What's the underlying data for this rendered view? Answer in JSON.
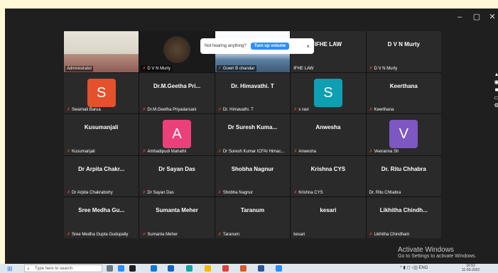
{
  "window": {
    "minimize": "–",
    "maximize": "▢",
    "close": "✕"
  },
  "notice": {
    "text": "Not hearing anything?",
    "button": "Turn up volume",
    "close": "×"
  },
  "tiles": [
    {
      "big": "",
      "label": "Administrator",
      "video": "admin"
    },
    {
      "big": "",
      "label": "D V N Murty",
      "video": "murty"
    },
    {
      "big": "",
      "label": "Gowri B chandar",
      "video": "gowri"
    },
    {
      "big": "IFHE LAW",
      "label": "IFHE LAW",
      "mic": false
    },
    {
      "big": "D V N Murty",
      "label": "D V N Murty"
    },
    {
      "avatar": "S",
      "color": "#e4512b",
      "label": "Swarnali Barua"
    },
    {
      "big": "Dr.M.Geetha Pri...",
      "label": "Dr.M.Geetha Priyadarsani"
    },
    {
      "big": "Dr. Himavathi. T",
      "label": "Dr. Himavathi. T"
    },
    {
      "avatar": "S",
      "color": "#0e9fb3",
      "label": "s ravi"
    },
    {
      "big": "Keerthana",
      "label": "Keerthana"
    },
    {
      "big": "Kusumanjali",
      "label": "Kusumanjali"
    },
    {
      "avatar": "A",
      "color": "#ec407a",
      "label": "Ambadipudi Mahathi"
    },
    {
      "big": "Dr Suresh Kuma...",
      "label": "Dr Suresh Kumar ICFAI Himac..."
    },
    {
      "big": "Anwesha",
      "label": "Anwesha"
    },
    {
      "avatar": "V",
      "color": "#7e57c2",
      "label": "Veeranna Sh"
    },
    {
      "big": "Dr Arpita Chakr...",
      "label": "Dr Arpita Chakraborty"
    },
    {
      "big": "Dr Sayan Das",
      "label": "Dr Sayan Das"
    },
    {
      "big": "Shobha Nagnur",
      "label": "Shobha Nagnur"
    },
    {
      "big": "Krishna CYS",
      "label": "Krishna CYS"
    },
    {
      "big": "Dr. Ritu Chhabra",
      "label": "Dr. Ritu Chhabra",
      "mic": false
    },
    {
      "big": "Sree Medha Gu...",
      "label": "Sree Medha Gupta Gudupally"
    },
    {
      "big": "Sumanta Meher",
      "label": "Sumanta Meher"
    },
    {
      "big": "Taranum",
      "label": "Taranum"
    },
    {
      "big": "kesari",
      "label": "kesari",
      "mic": false
    },
    {
      "big": "Likhitha Chindh...",
      "label": "Likhitha Chindham"
    }
  ],
  "watermark": {
    "line1": "Activate Windows",
    "line2": "Go to Settings to activate Windows."
  },
  "taskbar": {
    "search_placeholder": "Type here to search",
    "tray": "ENG",
    "time": "16:52",
    "date": "11-03-2022"
  },
  "colors": {
    "speaker": "#5fc95f",
    "muted": "#e0453a",
    "accent": "#2d8cff"
  }
}
